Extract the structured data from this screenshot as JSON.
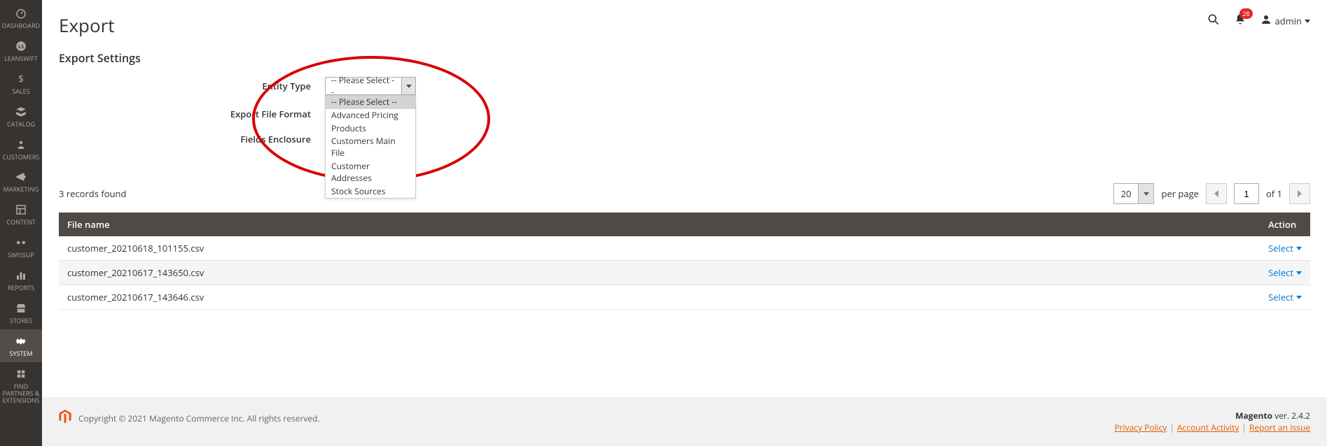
{
  "sidebar": {
    "items": [
      {
        "label": "DASHBOARD",
        "iconName": "dashboard-icon"
      },
      {
        "label": "LEANSWIFT",
        "iconName": "leanswift-icon"
      },
      {
        "label": "SALES",
        "iconName": "sales-icon"
      },
      {
        "label": "CATALOG",
        "iconName": "catalog-icon"
      },
      {
        "label": "CUSTOMERS",
        "iconName": "customers-icon"
      },
      {
        "label": "MARKETING",
        "iconName": "marketing-icon"
      },
      {
        "label": "CONTENT",
        "iconName": "content-icon"
      },
      {
        "label": "SWISSUP",
        "iconName": "swissup-icon"
      },
      {
        "label": "REPORTS",
        "iconName": "reports-icon"
      },
      {
        "label": "STORES",
        "iconName": "stores-icon"
      },
      {
        "label": "SYSTEM",
        "iconName": "system-icon",
        "active": true
      },
      {
        "label": "FIND PARTNERS & EXTENSIONS",
        "iconName": "partners-icon"
      }
    ]
  },
  "header": {
    "title": "Export",
    "notifCount": "28",
    "user": "admin"
  },
  "export": {
    "settingsTitle": "Export Settings",
    "entityTypeLabel": "Entity Type",
    "entityTypeSelected": "-- Please Select --",
    "entityTypeOptions": [
      "-- Please Select --",
      "Advanced Pricing",
      "Products",
      "Customers Main File",
      "Customer Addresses",
      "Stock Sources"
    ],
    "fileFormatLabel": "Export File Format",
    "fieldsEnclosureLabel": "Fields Enclosure"
  },
  "grid": {
    "recordsFoundPrefix": "3",
    "recordsFoundText": "records found",
    "perPageValue": "20",
    "perPageLabel": "per page",
    "pageCurrent": "1",
    "pageOf": "of",
    "pageTotal": "1",
    "columns": {
      "fileName": "File name",
      "action": "Action"
    },
    "actionLabel": "Select",
    "rows": [
      {
        "fileName": "customer_20210618_101155.csv"
      },
      {
        "fileName": "customer_20210617_143650.csv"
      },
      {
        "fileName": "customer_20210617_143646.csv"
      }
    ]
  },
  "footer": {
    "copyright": "Copyright © 2021 Magento Commerce Inc. All rights reserved.",
    "brand": "Magento",
    "version": "ver. 2.4.2",
    "links": {
      "privacy": "Privacy Policy",
      "account": "Account Activity",
      "report": "Report an Issue"
    }
  }
}
